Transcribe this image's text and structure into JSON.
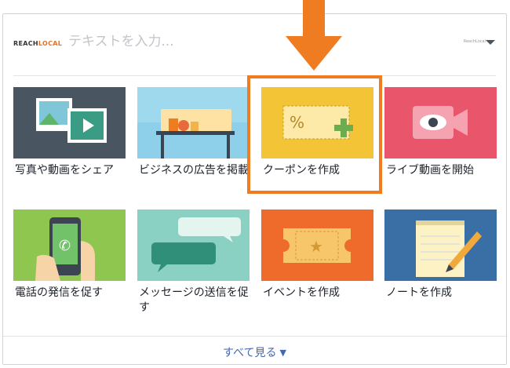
{
  "header": {
    "brand_part1": "REACH",
    "brand_part2": "LOCAL",
    "search_placeholder": "テキストを入力...",
    "account_label": "ReachLocal"
  },
  "cards": [
    {
      "label": "写真や動画をシェア",
      "icon": "photo-video-icon"
    },
    {
      "label": "ビジネスの広告を掲載",
      "icon": "store-ad-icon"
    },
    {
      "label": "クーポンを作成",
      "icon": "coupon-icon"
    },
    {
      "label": "ライブ動画を開始",
      "icon": "live-video-icon"
    },
    {
      "label": "電話の発信を促す",
      "icon": "phone-call-icon"
    },
    {
      "label": "メッセージの送信を促す",
      "icon": "message-icon"
    },
    {
      "label": "イベントを作成",
      "icon": "event-ticket-icon"
    },
    {
      "label": "ノートを作成",
      "icon": "note-icon"
    }
  ],
  "footer": {
    "see_all": "すべて見る"
  },
  "colors": {
    "highlight": "#f07c22",
    "link": "#4267b2",
    "brand_accent": "#e8731e"
  }
}
